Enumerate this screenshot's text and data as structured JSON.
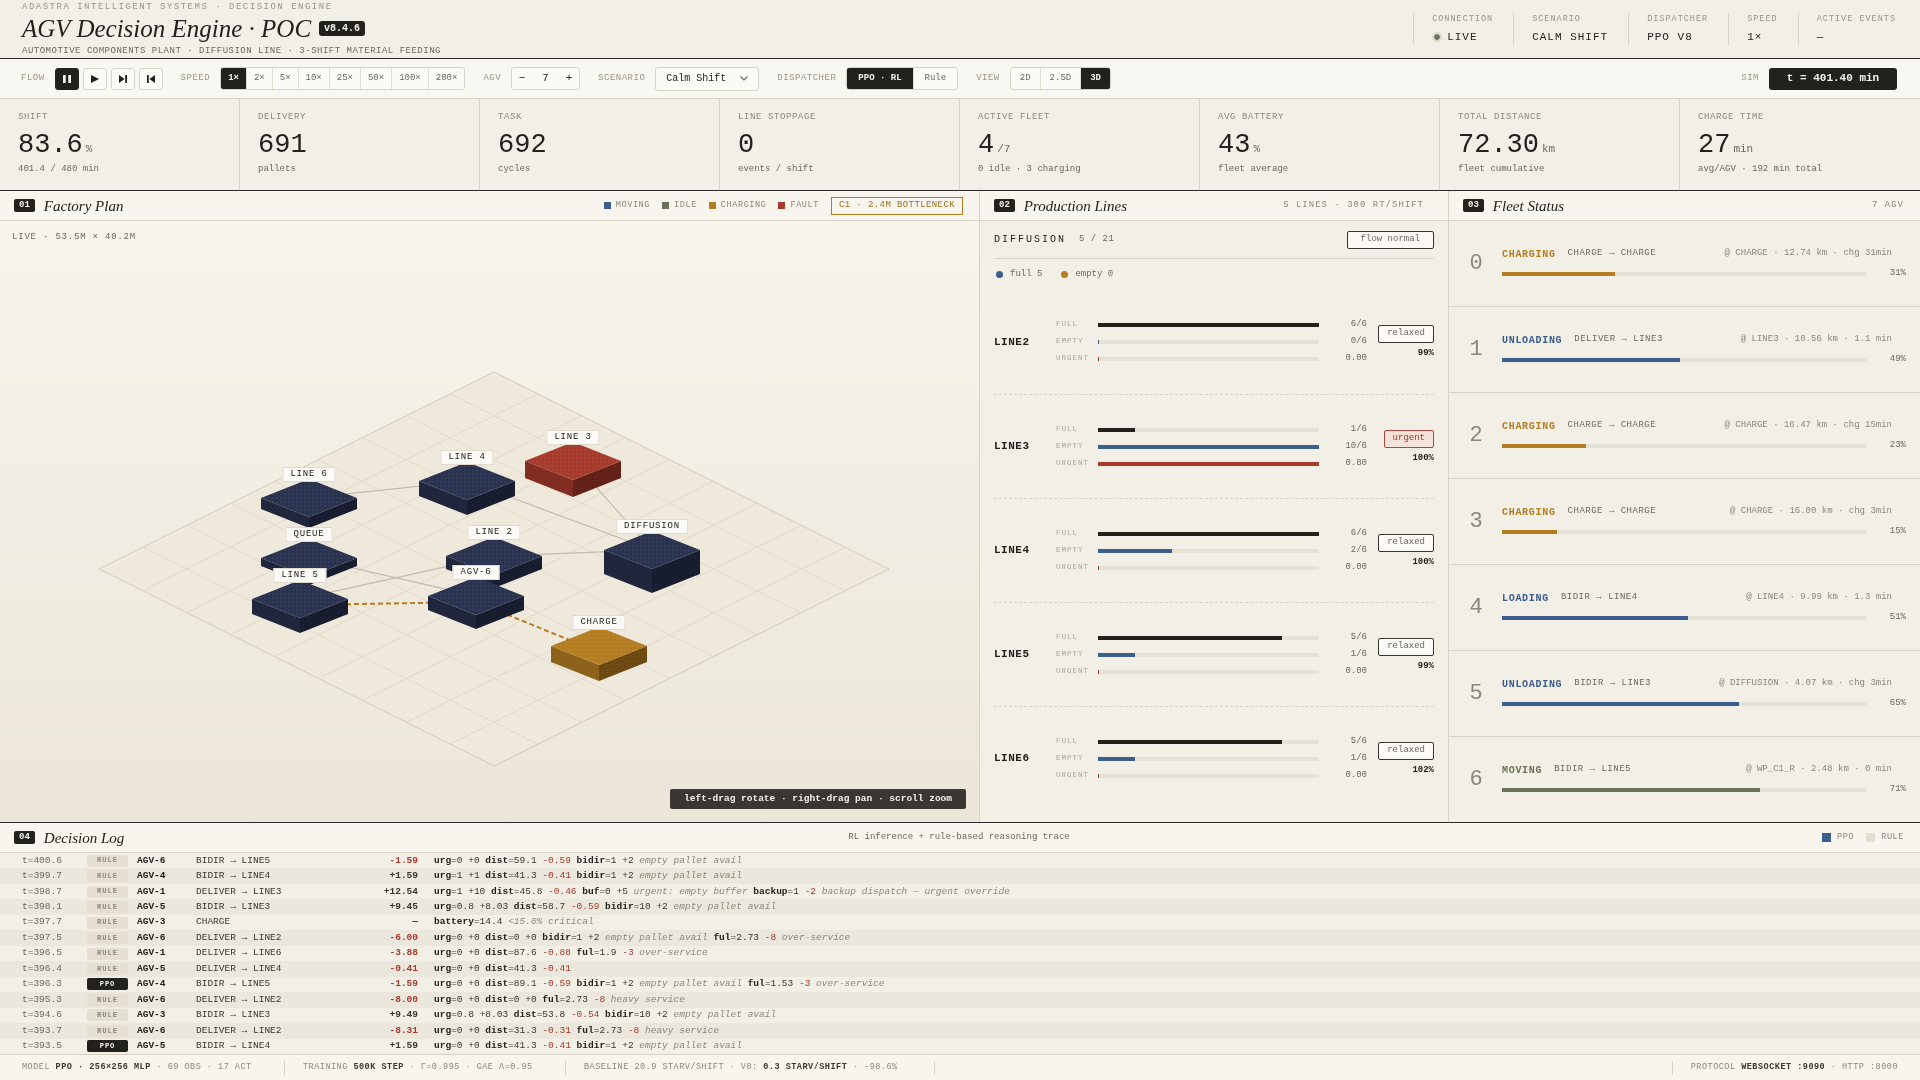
{
  "header": {
    "eyebrow": "ADASTRA INTELLIGENT SYSTEMS · DECISION ENGINE",
    "title": "AGV Decision Engine · POC",
    "version": "v8.4.6",
    "subtitle": "AUTOMOTIVE COMPONENTS PLANT · DIFFUSION LINE · 3-SHIFT MATERIAL FEEDING",
    "connection": {
      "label": "CONNECTION",
      "value": "LIVE",
      "online": true
    },
    "status": [
      {
        "label": "SCENARIO",
        "value": "CALM SHIFT"
      },
      {
        "label": "DISPATCHER",
        "value": "PPO V8"
      },
      {
        "label": "SPEED",
        "value": "1×"
      },
      {
        "label": "ACTIVE EVENTS",
        "value": "—"
      }
    ]
  },
  "toolbar": {
    "flow": {
      "label": "FLOW",
      "controls": [
        {
          "kind": "pause",
          "selected": true
        },
        {
          "kind": "play",
          "selected": false
        },
        {
          "kind": "step",
          "selected": false
        },
        {
          "kind": "reset",
          "selected": false
        }
      ]
    },
    "speed": {
      "label": "SPEED",
      "options": [
        {
          "label": "1×",
          "selected": true
        },
        {
          "label": "2×",
          "selected": false
        },
        {
          "label": "5×",
          "selected": false
        },
        {
          "label": "10×",
          "selected": false
        },
        {
          "label": "25×",
          "selected": false
        },
        {
          "label": "50×",
          "selected": false
        },
        {
          "label": "100×",
          "selected": false
        },
        {
          "label": "200×",
          "selected": false
        }
      ]
    },
    "agv": {
      "label": "AGV",
      "decrement": "−",
      "value": "7",
      "increment": "+"
    },
    "scenario": {
      "label": "SCENARIO",
      "value": "Calm Shift"
    },
    "dispatcher": {
      "label": "DISPATCHER",
      "options": [
        {
          "label": "PPO · RL",
          "selected": true
        },
        {
          "label": "Rule",
          "selected": false
        }
      ]
    },
    "view": {
      "label": "VIEW",
      "options": [
        {
          "label": "2D",
          "selected": false
        },
        {
          "label": "2.5D",
          "selected": false
        },
        {
          "label": "3D",
          "selected": true
        }
      ]
    },
    "sim": {
      "label": "SIM",
      "value": "t = 401.40 min"
    }
  },
  "kpis": [
    {
      "label": "SHIFT",
      "value": "83.6",
      "unit": "%",
      "note": "401.4 / 480 min"
    },
    {
      "label": "DELIVERY",
      "value": "691",
      "note": "pallets"
    },
    {
      "label": "TASK",
      "value": "692",
      "note": "cycles"
    },
    {
      "label": "LINE STOPPAGE",
      "value": "0",
      "note": "events / shift"
    },
    {
      "label": "ACTIVE FLEET",
      "value": "4",
      "unit": "/7",
      "note": "0 idle · 3 charging"
    },
    {
      "label": "AVG BATTERY",
      "value": "43",
      "unit": "%",
      "note": "fleet average"
    },
    {
      "label": "TOTAL DISTANCE",
      "value": "72.30",
      "unit": "km",
      "note": "fleet cumulative"
    },
    {
      "label": "CHARGE TIME",
      "value": "27",
      "unit": "min",
      "note": "avg/AGV · 192 min total"
    }
  ],
  "factory_plan": {
    "index": "01",
    "title": "Factory Plan",
    "legend": [
      {
        "label": "MOVING",
        "color": "#3d5d8f"
      },
      {
        "label": "IDLE",
        "color": "#6b7257"
      },
      {
        "label": "CHARGING",
        "color": "#b57d22"
      },
      {
        "label": "FAULT",
        "color": "#a63a2c"
      }
    ],
    "alert": "C1 · 2.4M BOTTLENECK",
    "caption": "LIVE · 53.5M × 40.2M",
    "nodes": [
      {
        "label": "LINE 3",
        "color": "#a63a2c"
      },
      {
        "label": "LINE 4",
        "color": "#29324e"
      },
      {
        "label": "LINE 6",
        "color": "#29324e"
      },
      {
        "label": "DIFFUSION",
        "color": "#29324e"
      },
      {
        "label": "LINE 2",
        "color": "#29324e"
      },
      {
        "label": "QUEUE",
        "color": "#29324e"
      },
      {
        "label": "AGV-6",
        "color": "#29324e"
      },
      {
        "label": "LINE 5",
        "color": "#29324e"
      },
      {
        "label": "CHARGE",
        "color": "#b57d22"
      }
    ],
    "hint": "left-drag rotate · right-drag pan · scroll zoom"
  },
  "production_lines": {
    "index": "02",
    "title": "Production Lines",
    "summary": "5 LINES · 300 RT/SHIFT",
    "source": {
      "name": "DIFFUSION",
      "count": "5 / 21",
      "status": "flow normal"
    },
    "legend": [
      {
        "label": "full 5",
        "color": "#3d5d8f"
      },
      {
        "label": "empty 0",
        "color": "#b57d22"
      }
    ],
    "lines": [
      {
        "name": "LINE2",
        "metrics": [
          {
            "kind": "full",
            "label": "FULL",
            "level": 1,
            "value": "6/6"
          },
          {
            "kind": "empty",
            "label": "EMPTY",
            "level": 0,
            "value": "0/6"
          },
          {
            "kind": "urgent",
            "label": "URGENT",
            "level": 0,
            "value": "0.00"
          }
        ],
        "status": "relaxed",
        "urgent": false,
        "load": "99%"
      },
      {
        "name": "LINE3",
        "metrics": [
          {
            "kind": "full",
            "label": "FULL",
            "level": 0.167,
            "value": "1/6"
          },
          {
            "kind": "empty",
            "label": "EMPTY",
            "level": 1,
            "value": "10/6"
          },
          {
            "kind": "urgent",
            "label": "URGENT",
            "level": 1,
            "value": "0.80"
          }
        ],
        "status": "urgent",
        "urgent": true,
        "load": "100%"
      },
      {
        "name": "LINE4",
        "metrics": [
          {
            "kind": "full",
            "label": "FULL",
            "level": 1,
            "value": "6/6"
          },
          {
            "kind": "empty",
            "label": "EMPTY",
            "level": 0.333,
            "value": "2/6"
          },
          {
            "kind": "urgent",
            "label": "URGENT",
            "level": 0,
            "value": "0.00"
          }
        ],
        "status": "relaxed",
        "urgent": false,
        "load": "100%"
      },
      {
        "name": "LINE5",
        "metrics": [
          {
            "kind": "full",
            "label": "FULL",
            "level": 0.833,
            "value": "5/6"
          },
          {
            "kind": "empty",
            "label": "EMPTY",
            "level": 0.167,
            "value": "1/6"
          },
          {
            "kind": "urgent",
            "label": "URGENT",
            "level": 0,
            "value": "0.00"
          }
        ],
        "status": "relaxed",
        "urgent": false,
        "load": "99%"
      },
      {
        "name": "LINE6",
        "metrics": [
          {
            "kind": "full",
            "label": "FULL",
            "level": 0.833,
            "value": "5/6"
          },
          {
            "kind": "empty",
            "label": "EMPTY",
            "level": 0.167,
            "value": "1/6"
          },
          {
            "kind": "urgent",
            "label": "URGENT",
            "level": 0,
            "value": "0.00"
          }
        ],
        "status": "relaxed",
        "urgent": false,
        "load": "102%"
      }
    ]
  },
  "fleet": {
    "index": "03",
    "title": "Fleet Status",
    "summary": "7 AGV",
    "agvs": [
      {
        "id": "0",
        "state": "CHARGING",
        "color": "#b57d22",
        "route": "CHARGE → CHARGE",
        "detail": "@ CHARGE · 12.74 km · chg 31min",
        "level": 0.31,
        "percent": "31%"
      },
      {
        "id": "1",
        "state": "UNLOADING",
        "color": "#3d5d8f",
        "route": "DELIVER → LINE3",
        "detail": "@ LINE3 · 10.56 km · 1.1 min",
        "level": 0.49,
        "percent": "49%"
      },
      {
        "id": "2",
        "state": "CHARGING",
        "color": "#b57d22",
        "route": "CHARGE → CHARGE",
        "detail": "@ CHARGE · 16.47 km · chg 15min",
        "level": 0.23,
        "percent": "23%"
      },
      {
        "id": "3",
        "state": "CHARGING",
        "color": "#b57d22",
        "route": "CHARGE → CHARGE",
        "detail": "@ CHARGE · 16.00 km · chg 3min",
        "level": 0.15,
        "percent": "15%"
      },
      {
        "id": "4",
        "state": "LOADING",
        "color": "#3d5d8f",
        "route": "BIDIR → LINE4",
        "detail": "@ LINE4 · 9.99 km · 1.3 min",
        "level": 0.51,
        "percent": "51%"
      },
      {
        "id": "5",
        "state": "UNLOADING",
        "color": "#3d5d8f",
        "route": "BIDIR → LINE3",
        "detail": "@ DIFFUSION · 4.07 km · chg 3min",
        "level": 0.65,
        "percent": "65%"
      },
      {
        "id": "6",
        "state": "MOVING",
        "color": "#6b7257",
        "route": "BIDIR → LINE5",
        "detail": "@ WP_C1_R · 2.48 km · 0 min",
        "level": 0.71,
        "percent": "71%"
      }
    ]
  },
  "decision_log": {
    "index": "04",
    "title": "Decision Log",
    "subtitle": "RL inference + rule-based reasoning trace",
    "legend": [
      {
        "label": "PPO",
        "color": "#3d5d8f"
      },
      {
        "label": "RULE",
        "color": "#e4dfd1"
      }
    ],
    "rows": [
      {
        "time": "t=400.6",
        "source": "RULE",
        "kind": "rule",
        "agv": "AGV-6",
        "action": "BIDIR → LINE5",
        "score": "-1.59",
        "negative": true,
        "terms": [
          {
            "expr": "**urg**=0",
            "delta": "+0",
            "negative": false
          },
          {
            "expr": "**dist**=59.1",
            "delta": "-0.59",
            "negative": true
          },
          {
            "expr": "**bidir**=1",
            "delta": "+2",
            "negative": false,
            "note": "empty pallet avail"
          }
        ]
      },
      {
        "time": "t=399.7",
        "source": "RULE",
        "kind": "rule",
        "agv": "AGV-4",
        "action": "BIDIR → LINE4",
        "score": "+1.59",
        "negative": false,
        "terms": [
          {
            "expr": "**urg**=1",
            "delta": "+1",
            "negative": false
          },
          {
            "expr": "**dist**=41.3",
            "delta": "-0.41",
            "negative": true
          },
          {
            "expr": "**bidir**=1",
            "delta": "+2",
            "negative": false,
            "note": "empty pallet avail"
          }
        ]
      },
      {
        "time": "t=398.7",
        "source": "RULE",
        "kind": "rule",
        "agv": "AGV-1",
        "action": "DELIVER → LINE3",
        "score": "+12.54",
        "negative": false,
        "terms": [
          {
            "expr": "**urg**=1",
            "delta": "+10",
            "negative": false
          },
          {
            "expr": "**dist**=45.8",
            "delta": "-0.46",
            "negative": true
          },
          {
            "expr": "**buf**=0",
            "delta": "+5",
            "negative": false,
            "note": "urgent: empty buffer"
          },
          {
            "expr": "**backup**=1",
            "delta": "-2",
            "negative": true,
            "note": "backup dispatch — urgent override"
          }
        ]
      },
      {
        "time": "t=398.1",
        "source": "RULE",
        "kind": "rule",
        "agv": "AGV-5",
        "action": "BIDIR → LINE3",
        "score": "+9.45",
        "negative": false,
        "terms": [
          {
            "expr": "**urg**=0.8",
            "delta": "+8.03",
            "negative": false
          },
          {
            "expr": "**dist**=58.7",
            "delta": "-0.59",
            "negative": true
          },
          {
            "expr": "**bidir**=10",
            "delta": "+2",
            "negative": false,
            "note": "empty pallet avail"
          }
        ]
      },
      {
        "time": "t=397.7",
        "source": "RULE",
        "kind": "rule",
        "agv": "AGV-3",
        "action": "CHARGE",
        "score": "—",
        "negative": false,
        "terms": [
          {
            "expr": "**battery**=14.4",
            "note": "<15.0% critical"
          }
        ]
      },
      {
        "time": "t=397.5",
        "source": "RULE",
        "kind": "rule",
        "agv": "AGV-6",
        "action": "DELIVER → LINE2",
        "score": "-6.00",
        "negative": true,
        "terms": [
          {
            "expr": "**urg**=0",
            "delta": "+0",
            "negative": false
          },
          {
            "expr": "**dist**=0",
            "delta": "+0",
            "negative": false
          },
          {
            "expr": "**bidir**=1",
            "delta": "+2",
            "negative": false,
            "note": "empty pallet avail"
          },
          {
            "expr": "**ful**=2.73",
            "delta": "-8",
            "negative": true,
            "note": "over-service"
          }
        ]
      },
      {
        "time": "t=396.5",
        "source": "RULE",
        "kind": "rule",
        "agv": "AGV-1",
        "action": "DELIVER → LINE6",
        "score": "-3.88",
        "negative": true,
        "terms": [
          {
            "expr": "**urg**=0",
            "delta": "+0",
            "negative": false
          },
          {
            "expr": "**dist**=87.6",
            "delta": "-0.88",
            "negative": true
          },
          {
            "expr": "**ful**=1.9",
            "delta": "-3",
            "negative": true,
            "note": "over-service"
          }
        ]
      },
      {
        "time": "t=396.4",
        "source": "RULE",
        "kind": "rule",
        "agv": "AGV-5",
        "action": "DELIVER → LINE4",
        "score": "-0.41",
        "negative": true,
        "terms": [
          {
            "expr": "**urg**=0",
            "delta": "+0",
            "negative": false
          },
          {
            "expr": "**dist**=41.3",
            "delta": "-0.41",
            "negative": true
          }
        ]
      },
      {
        "time": "t=396.3",
        "source": "PPO",
        "kind": "ppo",
        "agv": "AGV-4",
        "action": "BIDIR → LINE5",
        "score": "-1.59",
        "negative": true,
        "terms": [
          {
            "expr": "**urg**=0",
            "delta": "+0",
            "negative": false
          },
          {
            "expr": "**dist**=89.1",
            "delta": "-0.59",
            "negative": true
          },
          {
            "expr": "**bidir**=1",
            "delta": "+2",
            "negative": false,
            "note": "empty pallet avail"
          },
          {
            "expr": "**ful**=1.53",
            "delta": "-3",
            "negative": true,
            "note": "over-service"
          }
        ]
      },
      {
        "time": "t=395.3",
        "source": "RULE",
        "kind": "rule",
        "agv": "AGV-6",
        "action": "DELIVER → LINE2",
        "score": "-8.00",
        "negative": true,
        "terms": [
          {
            "expr": "**urg**=0",
            "delta": "+0",
            "negative": false
          },
          {
            "expr": "**dist**=0",
            "delta": "+0",
            "negative": false
          },
          {
            "expr": "**ful**=2.73",
            "delta": "-8",
            "negative": true,
            "note": "heavy service"
          }
        ]
      },
      {
        "time": "t=394.6",
        "source": "RULE",
        "kind": "rule",
        "agv": "AGV-3",
        "action": "BIDIR → LINE3",
        "score": "+9.49",
        "negative": false,
        "terms": [
          {
            "expr": "**urg**=0.8",
            "delta": "+8.03",
            "negative": false
          },
          {
            "expr": "**dist**=53.8",
            "delta": "-0.54",
            "negative": true
          },
          {
            "expr": "**bidir**=10",
            "delta": "+2",
            "negative": false,
            "note": "empty pallet avail"
          }
        ]
      },
      {
        "time": "t=393.7",
        "source": "RULE",
        "kind": "rule",
        "agv": "AGV-6",
        "action": "DELIVER → LINE2",
        "score": "-8.31",
        "negative": true,
        "terms": [
          {
            "expr": "**urg**=0",
            "delta": "+0",
            "negative": false
          },
          {
            "expr": "**dist**=31.3",
            "delta": "-0.31",
            "negative": true
          },
          {
            "expr": "**ful**=2.73",
            "delta": "-8",
            "negative": true,
            "note": "heavy service"
          }
        ]
      },
      {
        "time": "t=393.5",
        "source": "PPO",
        "kind": "ppo",
        "agv": "AGV-5",
        "action": "BIDIR → LINE4",
        "score": "+1.59",
        "negative": false,
        "terms": [
          {
            "expr": "**urg**=0",
            "delta": "+0",
            "negative": false
          },
          {
            "expr": "**dist**=41.3",
            "delta": "-0.41",
            "negative": true
          },
          {
            "expr": "**bidir**=1",
            "delta": "+2",
            "negative": false,
            "note": "empty pallet avail"
          }
        ]
      }
    ]
  },
  "footer": {
    "items": [
      "MODEL **PPO · 256×256 MLP** · 69 OBS · 17 ACT",
      "TRAINING **500K STEP** · Γ=0.995 · GAE Λ=0.95",
      "BASELINE 20.9 STARV/SHIFT · V8: **0.3 STARV/SHIFT** · -98.6%"
    ],
    "protocol": "PROTOCOL **WEBSOCKET :9090** · HTTP :8000"
  }
}
